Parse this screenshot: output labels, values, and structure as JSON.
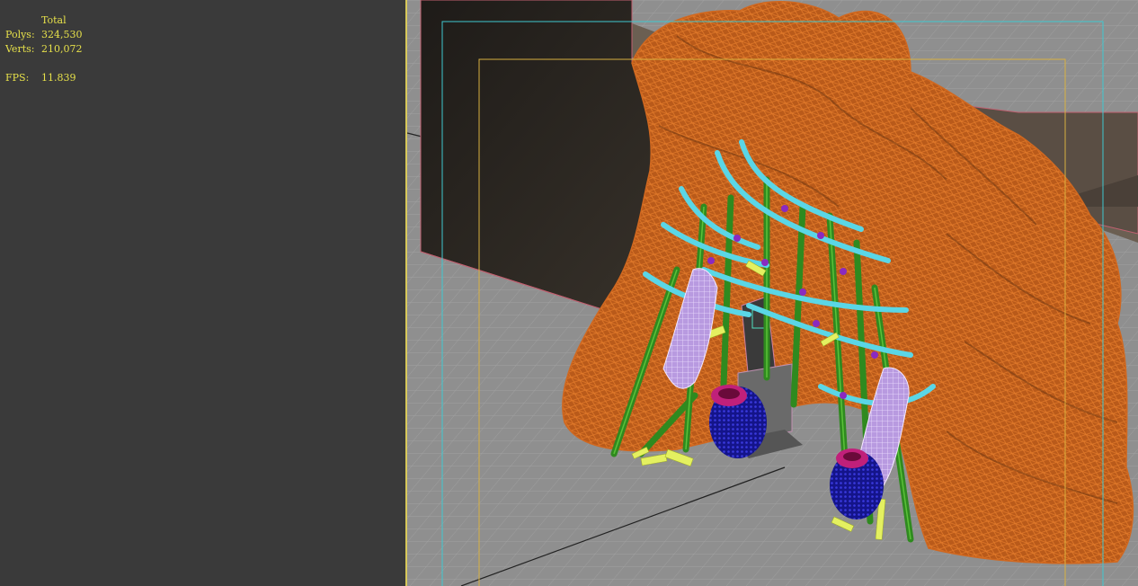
{
  "stats": {
    "header": "Total",
    "polys_label": "Polys:",
    "polys_value": "324,530",
    "verts_label": "Verts:",
    "verts_value": "210,072",
    "fps_label": "FPS:",
    "fps_value": "11.839"
  },
  "colors": {
    "stats_text": "#e6e04a",
    "left_pane_bg": "#3a3a3a",
    "viewport_grid_bg": "#8d8d8d",
    "rock_wireframe": "#c8601a",
    "bamboo": "#2f8a1f",
    "blades": "#5ad6e6",
    "cloth": "#d0a8f0",
    "urn": "#1a1a8a",
    "urn_rim": "#c0207a",
    "safe_frame_outer": "#3fc8d0",
    "safe_frame_inner": "#d8b040"
  },
  "viewport": {
    "scene_objects": [
      "wall",
      "floor-grid",
      "rock-formation",
      "bamboo-gate",
      "blades",
      "cloth-banners",
      "urns",
      "stone-pillar"
    ]
  }
}
